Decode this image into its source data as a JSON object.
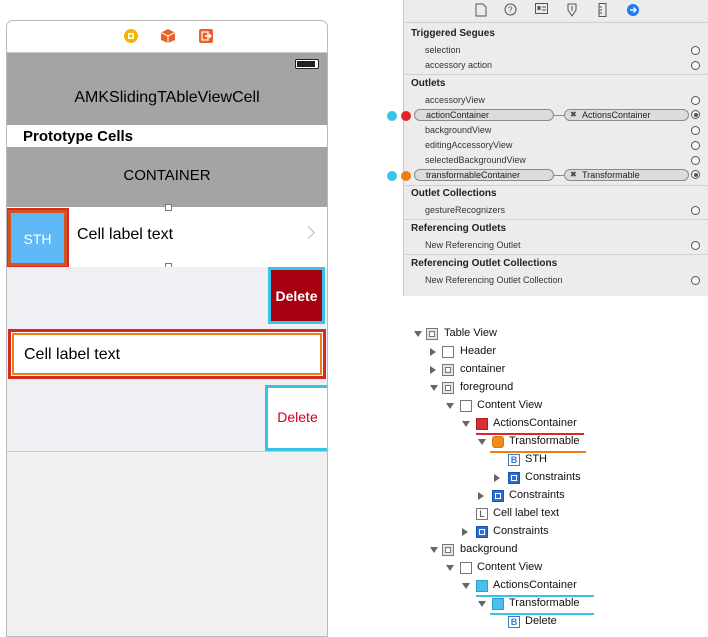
{
  "storyboard": {
    "scene_icons": [
      "view-controller-icon",
      "first-responder-icon",
      "exit-icon"
    ],
    "nav_title": "AMKSlidingTAbleViewCell",
    "section_header": "Prototype Cells",
    "container_label": "CONTAINER",
    "cell": {
      "badge": "STH",
      "label": "Cell label text"
    },
    "delete_red": "Delete",
    "cell2_label": "Cell label text",
    "delete_white": "Delete"
  },
  "inspector": {
    "tab_icons": [
      "file-icon",
      "help-icon",
      "identity-icon",
      "attributes-icon",
      "size-icon",
      "connections-icon"
    ],
    "triggered_segues": {
      "title": "Triggered Segues",
      "items": [
        "selection",
        "accessory action"
      ]
    },
    "outlets": {
      "title": "Outlets",
      "items": [
        "accessoryView",
        "actionContainer",
        "backgroundView",
        "editingAccessoryView",
        "selectedBackgroundView",
        "transformableContainer"
      ],
      "connections": {
        "actionContainer": "ActionsContainer",
        "transformableContainer": "Transformable"
      }
    },
    "outlet_collections": {
      "title": "Outlet Collections",
      "items": [
        "gestureRecognizers"
      ]
    },
    "referencing_outlets": {
      "title": "Referencing Outlets",
      "items": [
        "New Referencing Outlet"
      ]
    },
    "referencing_outlet_collections": {
      "title": "Referencing Outlet Collections",
      "items": [
        "New Referencing Outlet Collection"
      ]
    },
    "colors": {
      "red": "#e1262a",
      "orange": "#f07c18",
      "cyan": "#35c3e8"
    }
  },
  "outline": {
    "rows": [
      {
        "label": "Table View"
      },
      {
        "label": "Header"
      },
      {
        "label": "container"
      },
      {
        "label": "foreground"
      },
      {
        "label": "Content View"
      },
      {
        "label": "ActionsContainer"
      },
      {
        "label": "Transformable"
      },
      {
        "label": "STH",
        "icon_letter": "B"
      },
      {
        "label": "Constraints"
      },
      {
        "label": "Constraints"
      },
      {
        "label": "Cell label text",
        "icon_letter": "L"
      },
      {
        "label": "Constraints"
      },
      {
        "label": "background"
      },
      {
        "label": "Content View"
      },
      {
        "label": "ActionsContainer"
      },
      {
        "label": "Transformable"
      },
      {
        "label": "Delete",
        "icon_letter": "B"
      }
    ]
  }
}
